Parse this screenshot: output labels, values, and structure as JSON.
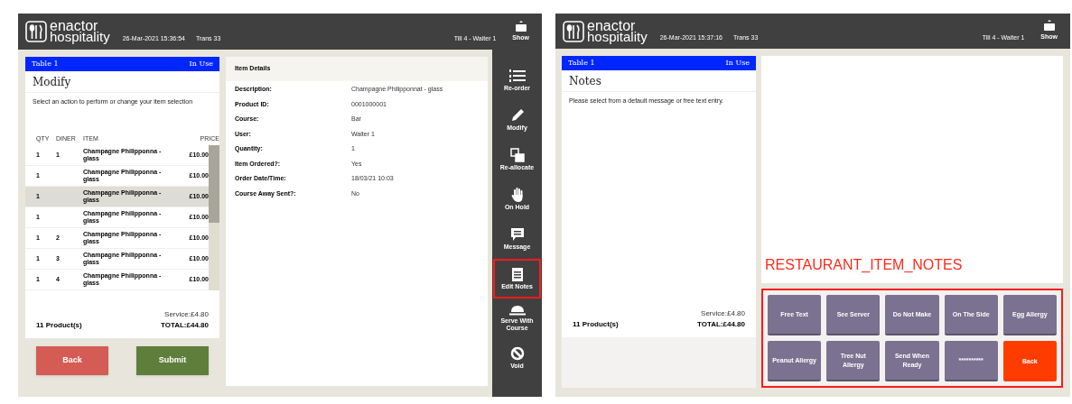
{
  "screens": [
    {
      "kind": "modify",
      "header": {
        "logo_top": "enactor",
        "logo_bottom": "hospitality",
        "datetime": "26-Mar-2021 15:36:54",
        "trans": "Trans 33",
        "till": "Till 4 - Waiter 1",
        "keyboard_label": "Show"
      },
      "table": {
        "name": "Table 1",
        "status": "In Use"
      },
      "title": "Modify",
      "instruction": "Select an action to perform or change your item selection",
      "columns": [
        "QTY",
        "DINER",
        "ITEM",
        "PRICE"
      ],
      "rows": [
        {
          "qty": "1",
          "diner": "1",
          "item": "Champagne Philipponna - glass",
          "price": "£10.00",
          "selected": false
        },
        {
          "qty": "1",
          "item": "Champagne Philipponna - glass",
          "price": "£10.00",
          "selected": false
        },
        {
          "qty": "1",
          "item": "Champagne Philipponna - glass",
          "price": "£10.00",
          "selected": true
        },
        {
          "qty": "1",
          "item": "Champagne Philipponna - glass",
          "price": "£10.00",
          "selected": false
        },
        {
          "qty": "1",
          "diner": "2",
          "item": "Champagne Philipponna - glass",
          "price": "£10.00",
          "selected": false
        },
        {
          "qty": "1",
          "diner": "3",
          "item": "Champagne Philipponna - glass",
          "price": "£10.00",
          "selected": false
        },
        {
          "qty": "1",
          "diner": "4",
          "item": "Champagne Philipponna - glass",
          "price": "£10.00",
          "selected": false
        }
      ],
      "count": "11 Product(s)",
      "service": "Service:£4.80",
      "total": "TOTAL:£44.80",
      "buttons": [
        {
          "label": "Back",
          "kind": "back"
        },
        {
          "label": "Submit",
          "kind": "submit"
        }
      ],
      "details": {
        "title": "Item Details",
        "fields": [
          {
            "label": "Description:",
            "value": "Champagne Philipponnat - glass"
          },
          {
            "label": "Product ID:",
            "value": "0001000001"
          },
          {
            "label": "Course:",
            "value": "Bar"
          },
          {
            "label": "User:",
            "value": "Waiter 1"
          },
          {
            "label": "Quantity:",
            "value": "1"
          },
          {
            "label": "Item Ordered?:",
            "value": "Yes"
          },
          {
            "label": "Order Date/Time:",
            "value": "18/03/21 10:03"
          },
          {
            "label": "Course Away Sent?:",
            "value": "No"
          }
        ]
      },
      "actions": [
        {
          "label": "Re-order",
          "kind": "reorder",
          "highlighted": false
        },
        {
          "label": "Modify",
          "kind": "modify",
          "highlighted": false
        },
        {
          "label": "Re-allocate",
          "kind": "reallocate",
          "highlighted": false
        },
        {
          "label": "On Hold",
          "kind": "hold",
          "highlighted": false
        },
        {
          "label": "Message",
          "kind": "message",
          "highlighted": false
        },
        {
          "label": "Edit Notes",
          "kind": "notes",
          "highlighted": true
        },
        {
          "label": "Serve With Course",
          "kind": "serve",
          "highlighted": false
        },
        {
          "label": "Void",
          "kind": "void",
          "highlighted": false
        }
      ]
    },
    {
      "kind": "notes",
      "header": {
        "logo_top": "enactor",
        "logo_bottom": "hospitality",
        "datetime": "26-Mar-2021 15:37:16",
        "trans": "Trans 33",
        "till": "Till 4 - Waiter 1",
        "keyboard_label": "Show"
      },
      "table": {
        "name": "Table 1",
        "status": "In Use"
      },
      "title": "Notes",
      "instruction": "Please select from a default message or free text entry.",
      "count": "11 Product(s)",
      "service": "Service:£4.80",
      "total": "TOTAL:£44.80",
      "annotation": "RESTAURANT_ITEM_NOTES",
      "note_buttons": {
        "highlighted": true,
        "items": [
          {
            "label": "Free Text",
            "kind": "note"
          },
          {
            "label": "See Server",
            "kind": "note"
          },
          {
            "label": "Do Not Make",
            "kind": "note"
          },
          {
            "label": "On The Side",
            "kind": "note"
          },
          {
            "label": "Egg Allergy",
            "kind": "note"
          },
          {
            "label": "Peanut Allergy",
            "kind": "note"
          },
          {
            "label": "Tree Nut Allergy",
            "kind": "note"
          },
          {
            "label": "Send When Ready",
            "kind": "note"
          },
          {
            "label": "**********",
            "kind": "note"
          },
          {
            "label": "Back",
            "kind": "back"
          }
        ]
      }
    }
  ]
}
